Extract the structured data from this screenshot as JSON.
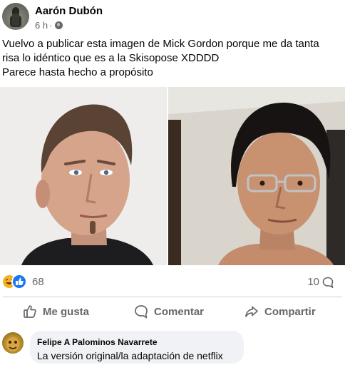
{
  "post": {
    "author": "Aarón Dubón",
    "time": "6 h",
    "separator": "·",
    "privacy_icon": "globe-icon",
    "text_lines": [
      "Vuelvo a publicar esta imagen de Mick Gordon porque me da tanta",
      "risa lo idéntico que es a la Skisopose XDDDD",
      "Parece hasta hecho a propósito"
    ]
  },
  "photos": {
    "left_icon": "portrait-photo",
    "right_icon": "selfie-photo"
  },
  "reactions": {
    "icons": [
      "haha-icon",
      "like-icon"
    ],
    "count": "68",
    "comments_count": "10"
  },
  "actions": {
    "like_label": "Me gusta",
    "comment_label": "Comentar",
    "share_label": "Compartir"
  },
  "comment": {
    "author": "Felipe A Palominos Navarrete",
    "text": "La versión original/la adaptación de netflix"
  },
  "colors": {
    "secondary_text": "#65676b",
    "like_blue": "#1877f2",
    "haha_yellow": "#f7b125",
    "bubble_bg": "#f0f2f5",
    "divider": "#ced0d4"
  }
}
